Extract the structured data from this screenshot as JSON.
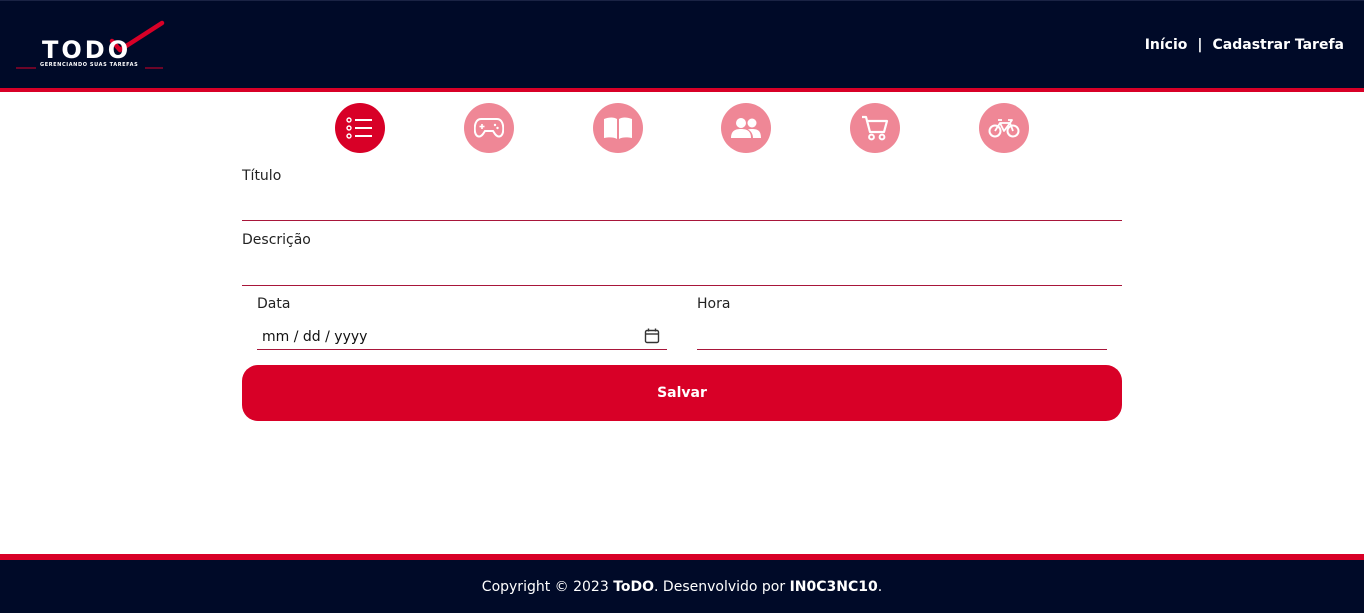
{
  "header": {
    "logo_text": "TODO",
    "logo_subtitle": "GERENCIANDO SUAS TAREFAS",
    "nav": [
      {
        "label": "Início"
      },
      {
        "label": "Cadastrar Tarefa"
      }
    ],
    "separator": "|"
  },
  "categories": [
    {
      "icon": "list-icon",
      "active": true
    },
    {
      "icon": "gamepad-icon",
      "active": false
    },
    {
      "icon": "book-icon",
      "active": false
    },
    {
      "icon": "users-icon",
      "active": false
    },
    {
      "icon": "shopping-cart-icon",
      "active": false
    },
    {
      "icon": "bicycle-icon",
      "active": false
    }
  ],
  "form": {
    "title_label": "Título",
    "title_value": "",
    "description_label": "Descrição",
    "description_value": "",
    "date_label": "Data",
    "date_placeholder": "mm / dd / yyyy",
    "time_label": "Hora",
    "time_value": "",
    "save_label": "Salvar"
  },
  "footer": {
    "prefix": "Copyright © 2023 ",
    "brand": "ToDO",
    "middle": ". Desenvolvido por ",
    "author": "IN0C3NC10",
    "suffix": "."
  },
  "colors": {
    "header_bg": "#000a28",
    "accent": "#d80027",
    "category_inactive": "#ef8796"
  }
}
